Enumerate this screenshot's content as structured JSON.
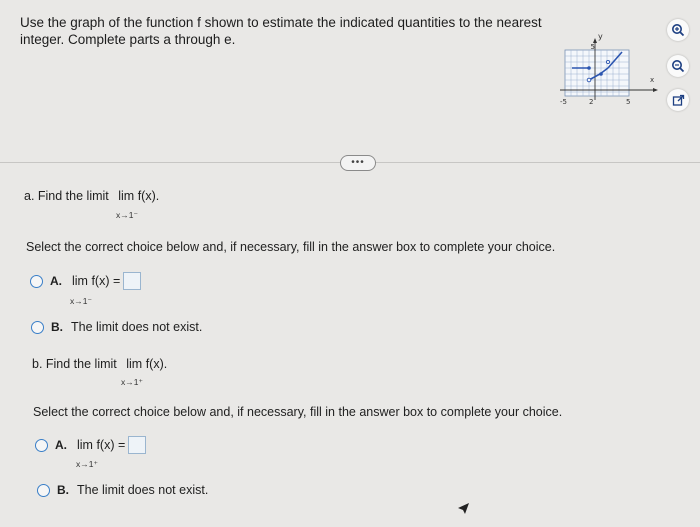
{
  "prompt": "Use the graph of the function f shown to estimate the indicated quantities to the nearest integer. Complete parts a through e.",
  "graph": {
    "y_label": "y",
    "x_label": "x",
    "y_tick": "5",
    "x_tick_neg": "-5",
    "x_tick_mid": "2",
    "x_tick_pos": "5"
  },
  "more_button": "•••",
  "part_a": {
    "question": "a. Find the limit",
    "limit_expr": "lim f(x).",
    "limit_sub": "x→1⁻",
    "instruction": "Select the correct choice below and, if necessary, fill in the answer box to complete your choice.",
    "choice_a_label": "A.",
    "choice_a_expr": "lim f(x) =",
    "choice_a_sub": "x→1⁻",
    "choice_b_label": "B.",
    "choice_b_text": "The limit does not exist."
  },
  "part_b": {
    "question": "b. Find the limit",
    "limit_expr": "lim f(x).",
    "limit_sub": "x→1⁺",
    "instruction": "Select the correct choice below and, if necessary, fill in the answer box to complete your choice.",
    "choice_a_label": "A.",
    "choice_a_expr": "lim f(x) =",
    "choice_a_sub": "x→1⁺",
    "choice_b_label": "B.",
    "choice_b_text": "The limit does not exist."
  },
  "tools": [
    "zoom-in-icon",
    "zoom-out-icon",
    "popout-icon"
  ]
}
